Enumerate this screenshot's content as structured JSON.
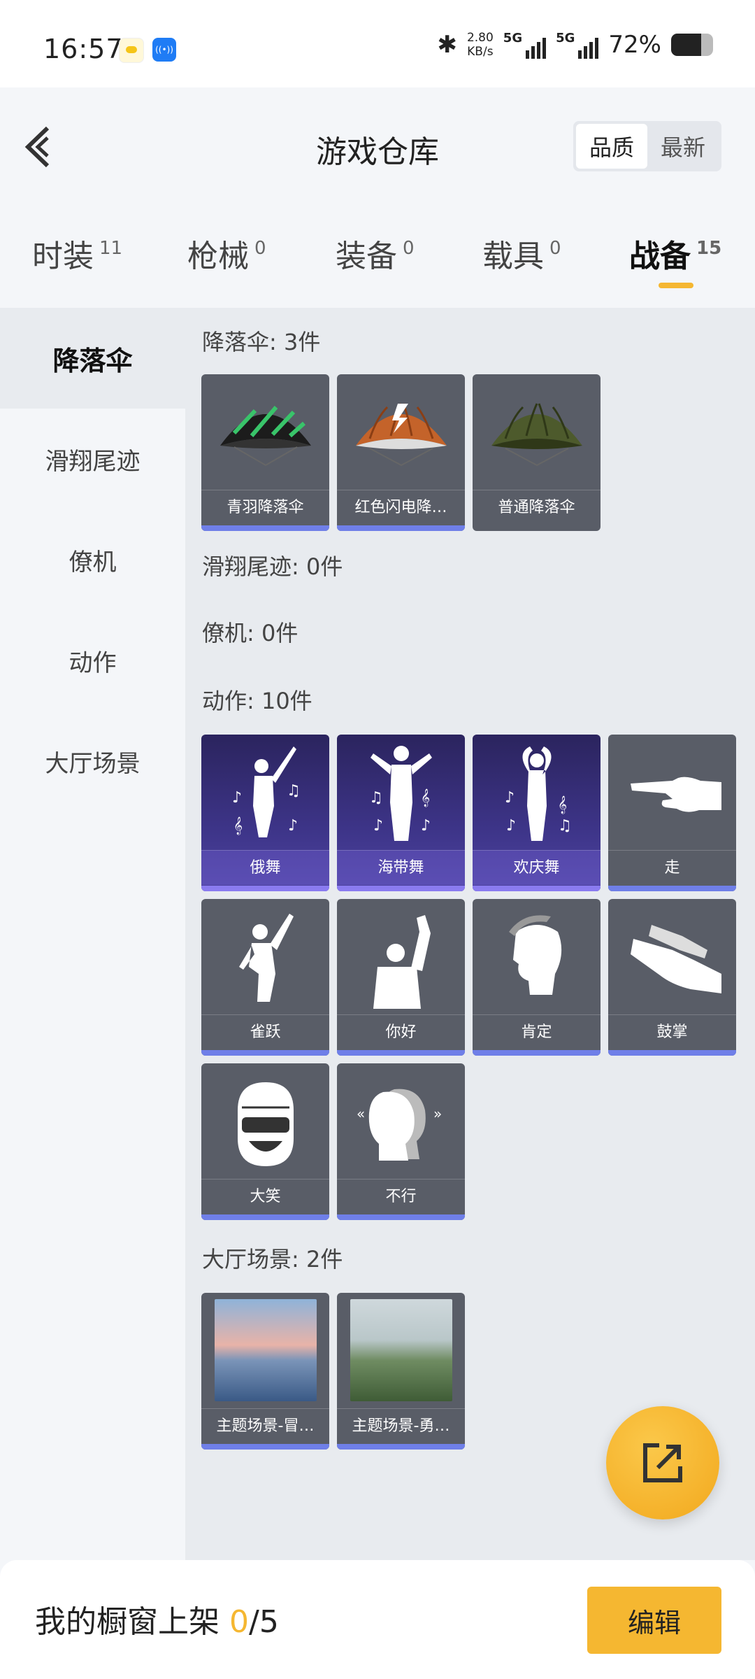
{
  "status": {
    "time": "16:57",
    "speed_value": "2.80",
    "speed_unit": "KB/s",
    "net1": "5G",
    "net2": "5G",
    "battery": "72%",
    "battery_level": 0.72
  },
  "header": {
    "title": "游戏仓库",
    "sort_quality": "品质",
    "sort_newest": "最新"
  },
  "tabs": [
    {
      "label": "时装",
      "count": "11"
    },
    {
      "label": "枪械",
      "count": "0"
    },
    {
      "label": "装备",
      "count": "0"
    },
    {
      "label": "载具",
      "count": "0"
    },
    {
      "label": "战备",
      "count": "15"
    }
  ],
  "sidebar": [
    "降落伞",
    "滑翔尾迹",
    "僚机",
    "动作",
    "大厅场景"
  ],
  "sections": {
    "parachute": {
      "title": "降落伞: 3件",
      "items": [
        "青羽降落伞",
        "红色闪电降…",
        "普通降落伞"
      ]
    },
    "trail": {
      "title": "滑翔尾迹: 0件"
    },
    "wingman": {
      "title": "僚机: 0件"
    },
    "emote": {
      "title": "动作: 10件",
      "items": [
        "俄舞",
        "海带舞",
        "欢庆舞",
        "走",
        "雀跃",
        "你好",
        "肯定",
        "鼓掌",
        "大笑",
        "不行"
      ]
    },
    "lobby": {
      "title": "大厅场景: 2件",
      "items": [
        "主题场景-冒…",
        "主题场景-勇…"
      ]
    }
  },
  "bottom": {
    "label": "我的橱窗上架",
    "current": "0",
    "total": "/5",
    "edit": "编辑"
  },
  "colors": {
    "accent": "#f5b731",
    "quality_bar": "#6f7fe8",
    "card": "#595d67",
    "purple_card": "#3d3488"
  }
}
